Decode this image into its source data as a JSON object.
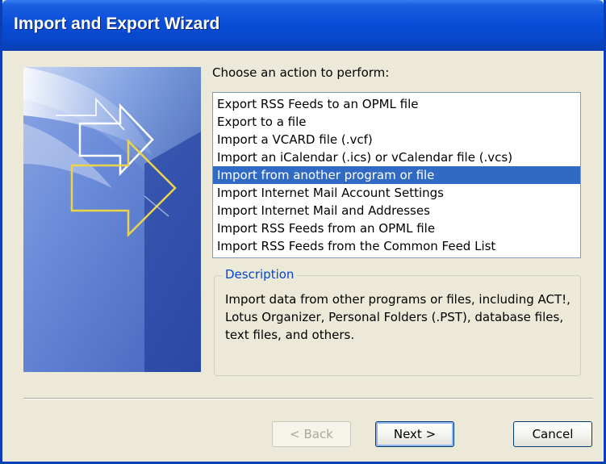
{
  "window": {
    "title": "Import and Export Wizard"
  },
  "main": {
    "prompt": "Choose an action to perform:",
    "actions": [
      {
        "label": "Export RSS Feeds to an OPML file",
        "selected": false
      },
      {
        "label": "Export to a file",
        "selected": false
      },
      {
        "label": "Import a VCARD file (.vcf)",
        "selected": false
      },
      {
        "label": "Import an iCalendar (.ics) or vCalendar file (.vcs)",
        "selected": false
      },
      {
        "label": "Import from another program or file",
        "selected": true
      },
      {
        "label": "Import Internet Mail Account Settings",
        "selected": false
      },
      {
        "label": "Import Internet Mail and Addresses",
        "selected": false
      },
      {
        "label": "Import RSS Feeds from an OPML file",
        "selected": false
      },
      {
        "label": "Import RSS Feeds from the Common Feed List",
        "selected": false
      }
    ],
    "description": {
      "legend": "Description",
      "text": "Import data from other programs or files, including ACT!, Lotus Organizer, Personal Folders (.PST), database files, text files, and others."
    }
  },
  "buttons": {
    "back": {
      "label": "< Back",
      "enabled": false
    },
    "next": {
      "label": "Next >",
      "enabled": true
    },
    "cancel": {
      "label": "Cancel",
      "enabled": true
    }
  },
  "colors": {
    "titlebar": "#0a4fd8",
    "selection": "#316ac5",
    "legend": "#0046d5",
    "dialog_bg": "#ece9d8"
  },
  "icons": {
    "side_graphic": "wizard-arrows-banner"
  }
}
